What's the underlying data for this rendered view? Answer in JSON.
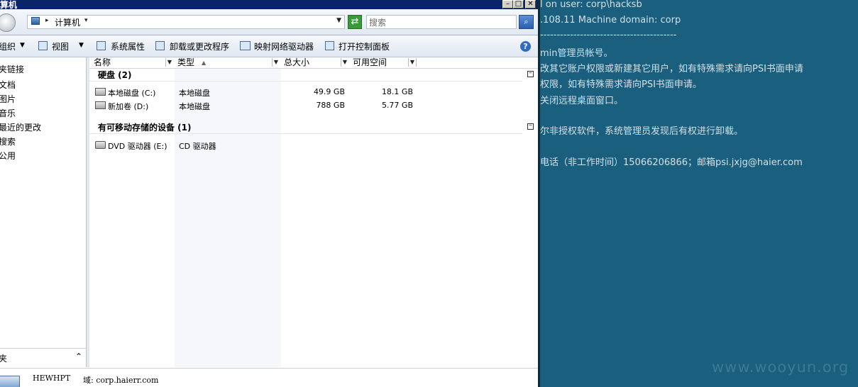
{
  "window": {
    "title": "算机",
    "min_glyph": "–",
    "max_glyph": "□",
    "close_glyph": "✕"
  },
  "address": {
    "path_label": "计算机",
    "search_placeholder": "搜索"
  },
  "toolbar": {
    "organize": "组织",
    "views": "视图",
    "system_properties": "系统属性",
    "uninstall": "卸载或更改程序",
    "map_drive": "映射网络驱动器",
    "control_panel": "打开控制面板"
  },
  "nav": {
    "items": [
      "夹链接",
      "文档",
      "图片",
      "音乐",
      "最近的更改",
      "搜索",
      "公用"
    ],
    "folders_label": "夹"
  },
  "columns": {
    "name": "名称",
    "type": "类型",
    "total_size": "总大小",
    "free_space": "可用空间"
  },
  "groups": {
    "hard_disks": {
      "label": "硬盘 (2)",
      "drives": [
        {
          "name": "本地磁盘 (C:)",
          "type": "本地磁盘",
          "total": "49.9 GB",
          "free": "18.1 GB"
        },
        {
          "name": "新加卷 (D:)",
          "type": "本地磁盘",
          "total": "788 GB",
          "free": "5.77 GB"
        }
      ]
    },
    "removable": {
      "label": "有可移动存储的设备 (1)",
      "drives": [
        {
          "name": "DVD 驱动器 (E:)",
          "type": "CD 驱动器"
        }
      ]
    }
  },
  "status": {
    "computer_name": "HEWHPT",
    "domain": "域: corp.haierr.com"
  },
  "terminal": {
    "lines": [
      "l on user: corp\\hacksb",
      ".108.11    Machine domain: corp",
      "-----------------------------------------",
      "min管理员帐号。",
      "改其它账户权限或新建其它用户，如有特殊需求请向PSI书面申请",
      "权限，如有特殊需求请向PSI书面申请。",
      "关闭远程桌面窗口。",
      "尔非授权软件，系统管理员发现后有权进行卸载。",
      "电话（非工作时间）15066206866；邮箱psi.jxjg@haier.com"
    ]
  },
  "watermark": "www.wooyun.org"
}
